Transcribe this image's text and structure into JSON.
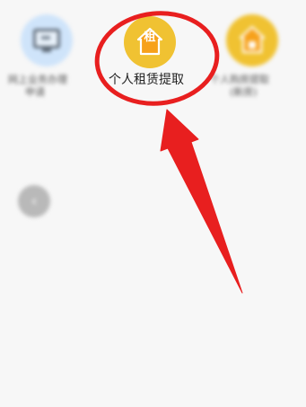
{
  "services": [
    {
      "name": "online-business",
      "label_line1": "网上业务办理",
      "label_line2": "申请",
      "icon": "monitor-icon",
      "color": "#cfe4fa"
    },
    {
      "name": "rent-withdrawal",
      "label": "个人租赁提取",
      "icon_char": "租",
      "icon": "house-icon",
      "color": "#f0c232"
    },
    {
      "name": "housing-withdrawal",
      "label_line1": "个人购房提取",
      "label_line2": "(新房)",
      "icon": "house-icon",
      "color": "#f0c232"
    }
  ],
  "annotation": {
    "color": "#e81f1f"
  },
  "back_button": {
    "glyph": "‹"
  }
}
